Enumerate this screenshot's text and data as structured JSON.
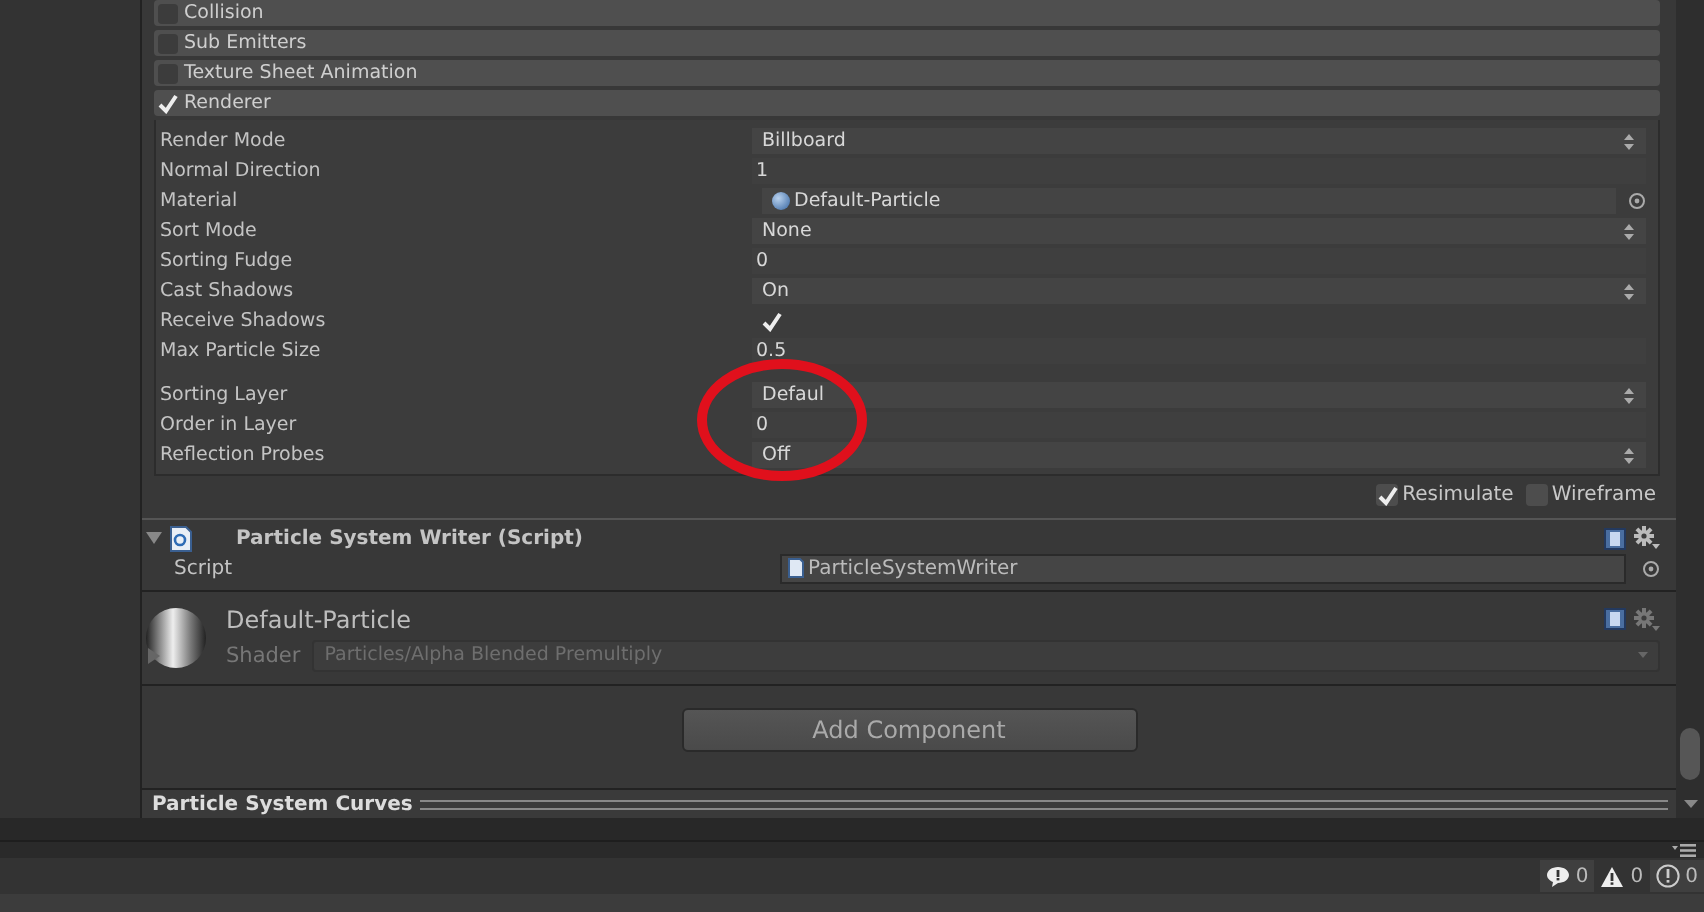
{
  "modules": [
    {
      "label": "Collision",
      "enabled": false
    },
    {
      "label": "Sub Emitters",
      "enabled": false
    },
    {
      "label": "Texture Sheet Animation",
      "enabled": false
    },
    {
      "label": "Renderer",
      "enabled": true
    }
  ],
  "renderer_properties": [
    {
      "label": "Render Mode",
      "kind": "dropdown",
      "value": "Billboard"
    },
    {
      "label": "Normal Direction",
      "kind": "text",
      "value": "1"
    },
    {
      "label": "Material",
      "kind": "object",
      "value": "Default-Particle"
    },
    {
      "label": "Sort Mode",
      "kind": "dropdown",
      "value": "None"
    },
    {
      "label": "Sorting Fudge",
      "kind": "text",
      "value": "0"
    },
    {
      "label": "Cast Shadows",
      "kind": "dropdown",
      "value": "On"
    },
    {
      "label": "Receive Shadows",
      "kind": "checkbox",
      "checked": true
    },
    {
      "label": "Max Particle Size",
      "kind": "text",
      "value": "0.5"
    }
  ],
  "sorting_properties": [
    {
      "label": "Sorting Layer",
      "kind": "dropdown",
      "value": "Defaul"
    },
    {
      "label": "Order in Layer",
      "kind": "text",
      "value": "0"
    },
    {
      "label": "Reflection Probes",
      "kind": "dropdown",
      "value": "Off"
    }
  ],
  "preview_toggles": [
    {
      "label": "Resimulate",
      "checked": true
    },
    {
      "label": "Wireframe",
      "checked": false
    }
  ],
  "script_component": {
    "title": "Particle System Writer (Script)",
    "expanded": true,
    "field_label": "Script",
    "field_value": "ParticleSystemWriter"
  },
  "material_component": {
    "name": "Default-Particle",
    "expanded": false,
    "shader_label": "Shader",
    "shader_value": "Particles/Alpha Blended Premultiply"
  },
  "add_component_button": "Add Component",
  "curves_title": "Particle System Curves",
  "console_counts": [
    {
      "kind": "message",
      "count": "0"
    },
    {
      "kind": "warning",
      "count": "0"
    },
    {
      "kind": "error",
      "count": "0"
    }
  ]
}
